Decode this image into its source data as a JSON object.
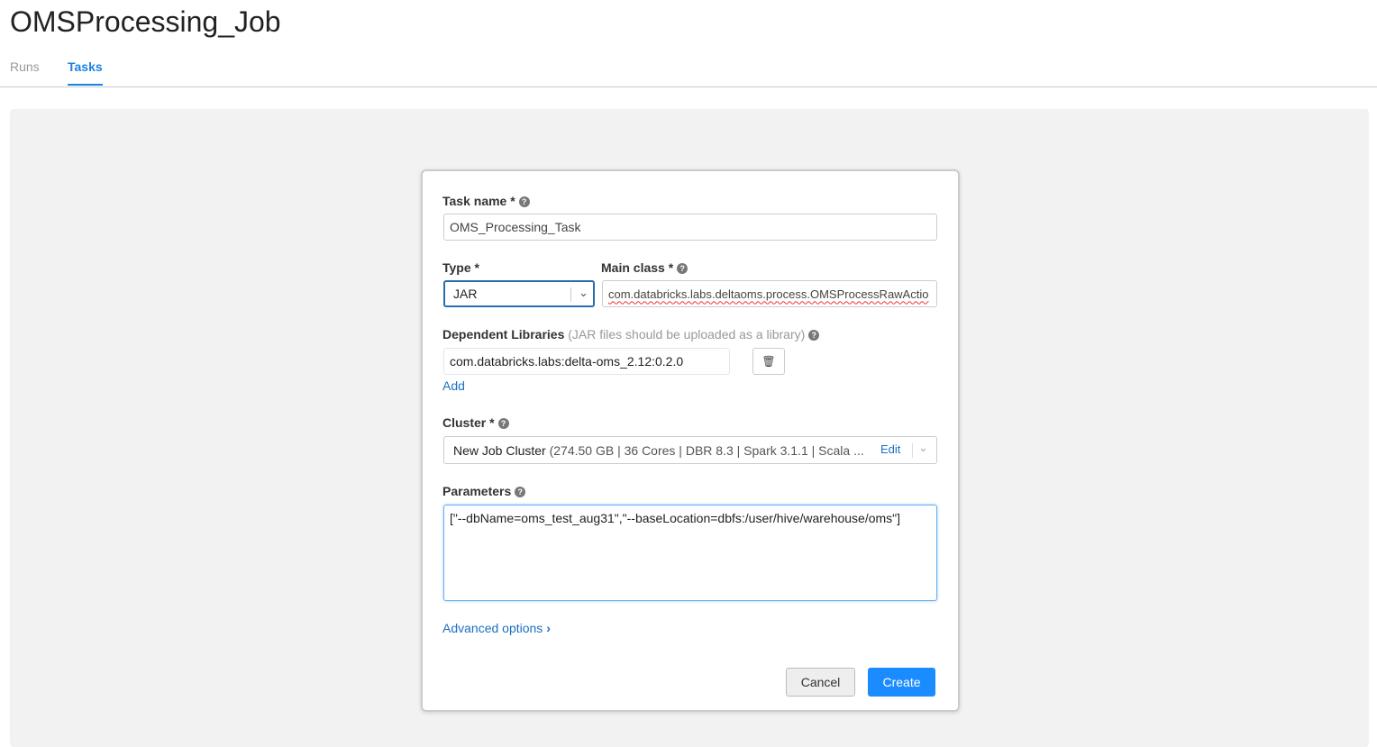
{
  "page": {
    "title": "OMSProcessing_Job",
    "tabs": [
      {
        "label": "Runs",
        "active": false
      },
      {
        "label": "Tasks",
        "active": true
      }
    ]
  },
  "form": {
    "task_name": {
      "label": "Task name *",
      "value": "OMS_Processing_Task"
    },
    "type": {
      "label": "Type *",
      "value": "JAR"
    },
    "main_class": {
      "label": "Main class *",
      "value": "com.databricks.labs.deltaoms.process.OMSProcessRawActio"
    },
    "dependent_libraries": {
      "label": "Dependent Libraries",
      "hint": "(JAR files should be uploaded as a library)",
      "value": "com.databricks.labs:delta-oms_2.12:0.2.0",
      "add_label": "Add"
    },
    "cluster": {
      "label": "Cluster *",
      "name": "New Job Cluster",
      "details": "(274.50 GB | 36 Cores | DBR 8.3 | Spark 3.1.1 | Scala ...",
      "edit_label": "Edit"
    },
    "parameters": {
      "label": "Parameters",
      "value": "[\"--dbName=oms_test_aug31\",\"--baseLocation=dbfs:/user/hive/warehouse/oms\"]"
    },
    "advanced_label": "Advanced options",
    "cancel_label": "Cancel",
    "create_label": "Create"
  },
  "colors": {
    "accent": "#1a82e2",
    "primary_button": "#1a8cff"
  }
}
